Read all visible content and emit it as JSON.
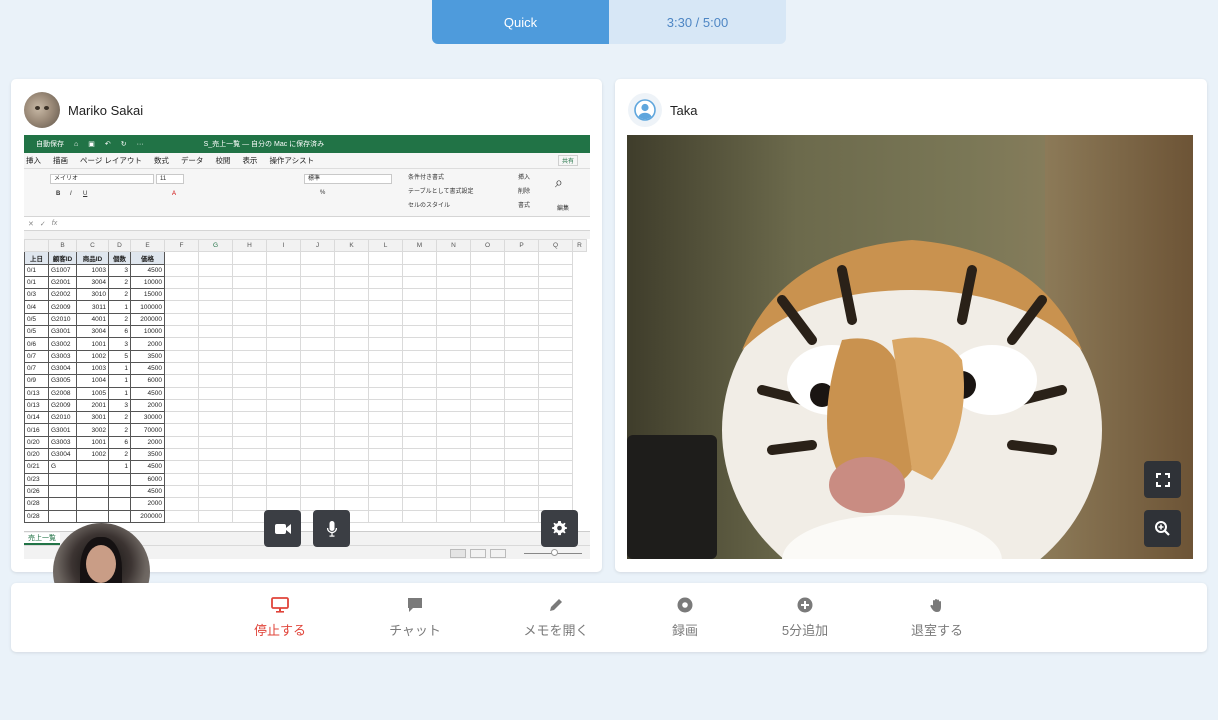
{
  "topbar": {
    "mode": "Quick",
    "timer": "3:30 / 5:00"
  },
  "left_panel": {
    "name": "Mariko Sakai",
    "excel": {
      "autosave": "自動保存",
      "title": "S_売上一覧 — 自分の Mac に保存済み",
      "menu": [
        "挿入",
        "描画",
        "ページ レイアウト",
        "数式",
        "データ",
        "校閲",
        "表示",
        "操作アシスト"
      ],
      "share": "共有",
      "font": "メイリオ",
      "size": "11",
      "number_format": "標準",
      "conditional": "条件付き書式",
      "table_format": "テーブルとして書式設定",
      "cell_style": "セルのスタイル",
      "insert": "挿入",
      "delete": "削除",
      "format": "書式",
      "edit": "編集",
      "columns": [
        "B",
        "C",
        "D",
        "E",
        "F",
        "G",
        "H",
        "I",
        "J",
        "K",
        "L",
        "M",
        "N",
        "O",
        "P",
        "Q",
        "R"
      ],
      "headers": [
        "上日",
        "顧客ID",
        "商品ID",
        "個数",
        "価格"
      ],
      "rows": [
        [
          "0/1",
          "G1007",
          "1003",
          "3",
          "4500"
        ],
        [
          "0/1",
          "G2001",
          "3004",
          "2",
          "10000"
        ],
        [
          "0/3",
          "G2002",
          "3010",
          "2",
          "15000"
        ],
        [
          "0/4",
          "G2009",
          "3011",
          "1",
          "100000"
        ],
        [
          "0/5",
          "G2010",
          "4001",
          "2",
          "200000"
        ],
        [
          "0/5",
          "G3001",
          "3004",
          "6",
          "10000"
        ],
        [
          "0/6",
          "G3002",
          "1001",
          "3",
          "2000"
        ],
        [
          "0/7",
          "G3003",
          "1002",
          "5",
          "3500"
        ],
        [
          "0/7",
          "G3004",
          "1003",
          "1",
          "4500"
        ],
        [
          "0/9",
          "G3005",
          "1004",
          "1",
          "6000"
        ],
        [
          "0/13",
          "G2008",
          "1005",
          "1",
          "4500"
        ],
        [
          "0/13",
          "G2009",
          "2001",
          "3",
          "2000"
        ],
        [
          "0/14",
          "G2010",
          "3001",
          "2",
          "30000"
        ],
        [
          "0/16",
          "G3001",
          "3002",
          "2",
          "70000"
        ],
        [
          "0/20",
          "G3003",
          "1001",
          "6",
          "2000"
        ],
        [
          "0/20",
          "G3004",
          "1002",
          "2",
          "3500"
        ],
        [
          "0/21",
          "G",
          "",
          "1",
          "4500"
        ],
        [
          "0/23",
          "",
          "",
          "",
          "6000"
        ],
        [
          "0/26",
          "",
          "",
          "",
          "4500"
        ],
        [
          "0/28",
          "",
          "",
          "",
          "2000"
        ],
        [
          "0/28",
          "",
          "",
          "",
          "200000"
        ]
      ],
      "sheet_tab": "売上一覧",
      "plus": "+"
    }
  },
  "right_panel": {
    "name": "Taka"
  },
  "toolbar": {
    "stop": "停止する",
    "chat": "チャット",
    "memo": "メモを開く",
    "record": "録画",
    "add5": "5分追加",
    "leave": "退室する"
  },
  "colors": {
    "accent": "#4e9bdc",
    "danger": "#e0443a",
    "excel_green": "#217346"
  }
}
